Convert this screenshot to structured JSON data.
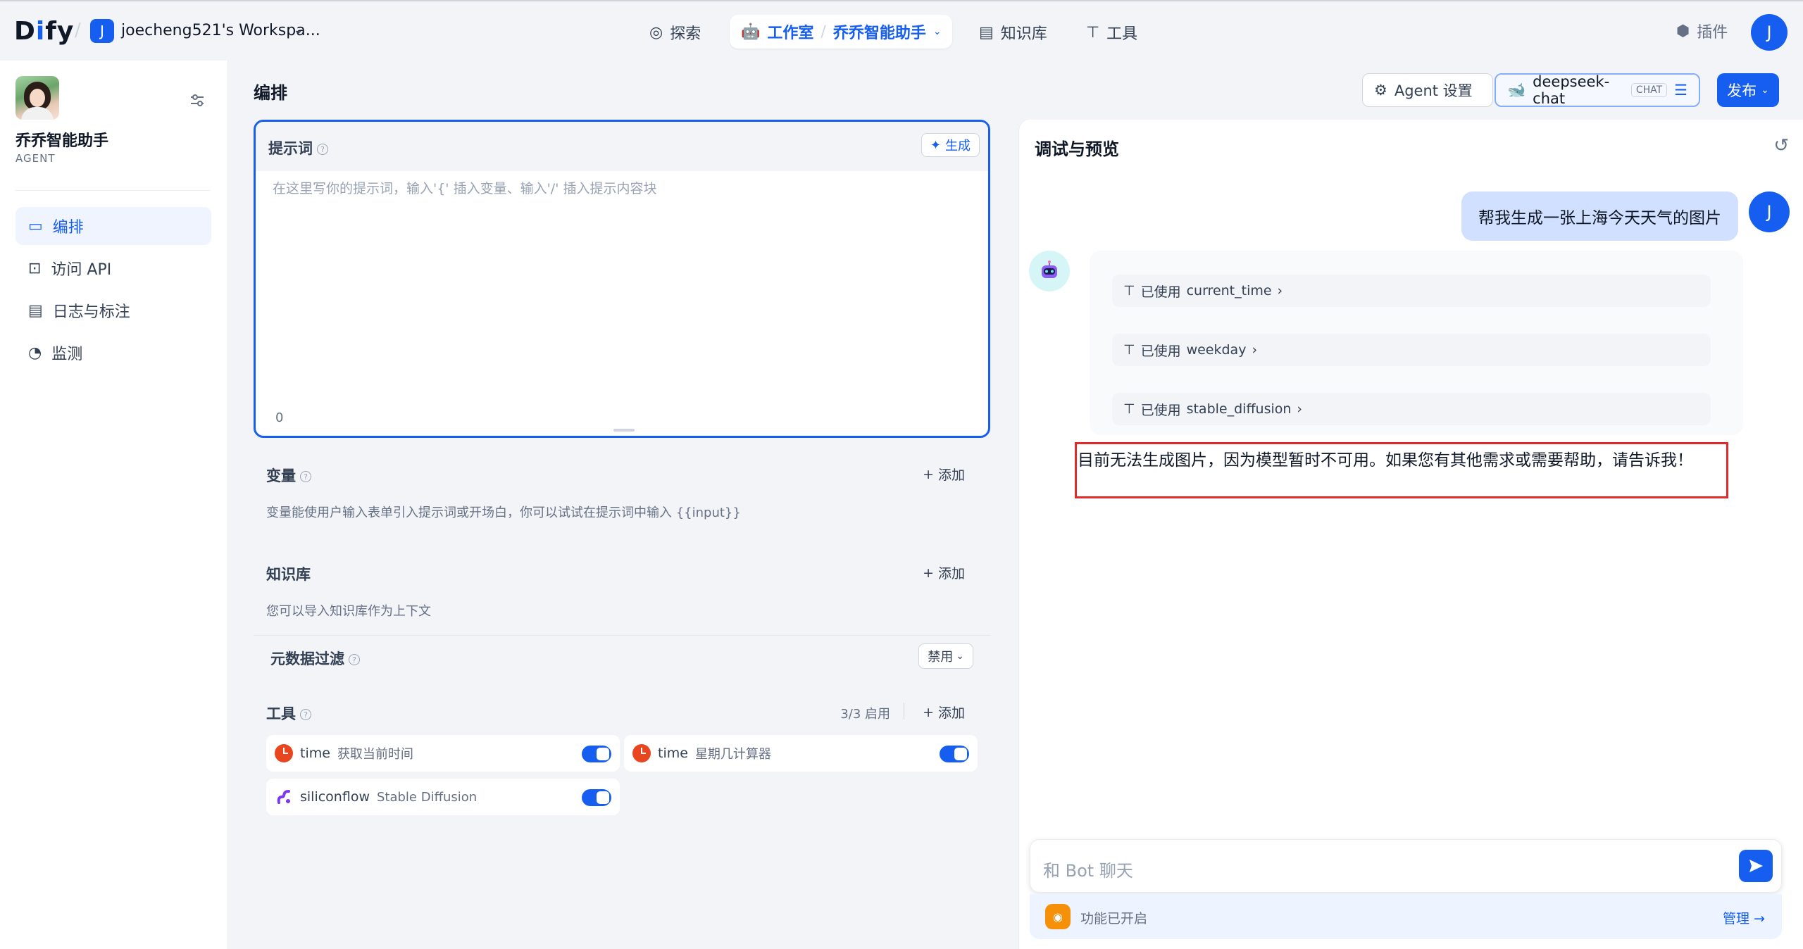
{
  "header": {
    "logo": "Dify",
    "workspace_initial": "J",
    "workspace_name": "joecheng521's Workspa...",
    "nav": {
      "explore": "探索",
      "studio": "工作室",
      "current_app": "乔乔智能助手",
      "knowledge": "知识库",
      "tools": "工具"
    },
    "plugins": "插件",
    "user_initial": "J"
  },
  "sidebar": {
    "app_name": "乔乔智能助手",
    "app_type": "AGENT",
    "items": [
      {
        "label": "编排",
        "icon": "layout-icon"
      },
      {
        "label": "访问 API",
        "icon": "terminal-icon"
      },
      {
        "label": "日志与标注",
        "icon": "log-icon"
      },
      {
        "label": "监测",
        "icon": "gauge-icon"
      }
    ]
  },
  "main": {
    "title": "编排",
    "agent_settings": "Agent 设置",
    "model_name": "deepseek-chat",
    "model_badge": "CHAT",
    "publish": "发布",
    "prompt": {
      "label": "提示词",
      "generate": "生成",
      "placeholder": "在这里写你的提示词，输入'{' 插入变量、输入'/' 插入提示内容块",
      "count": "0"
    },
    "variables": {
      "title": "变量",
      "add": "添加",
      "desc": "变量能使用户输入表单引入提示词或开场白，你可以试试在提示词中输入 {{input}}"
    },
    "knowledge": {
      "title": "知识库",
      "add": "添加",
      "desc": "您可以导入知识库作为上下文",
      "metadata_filter": "元数据过滤",
      "metadata_value": "禁用"
    },
    "tools": {
      "title": "工具",
      "enabled": "3/3 启用",
      "add": "添加",
      "items": [
        {
          "name": "time",
          "desc": "获取当前时间",
          "enabled": true
        },
        {
          "name": "time",
          "desc": "星期几计算器",
          "enabled": true
        },
        {
          "name": "siliconflow",
          "desc": "Stable Diffusion",
          "enabled": true
        }
      ]
    }
  },
  "debug": {
    "title": "调试与预览",
    "user_message": "帮我生成一张上海今天天气的图片",
    "user_initial": "J",
    "tools_used": [
      {
        "prefix": "已使用",
        "name": "current_time"
      },
      {
        "prefix": "已使用",
        "name": "weekday"
      },
      {
        "prefix": "已使用",
        "name": "stable_diffusion"
      }
    ],
    "bot_reply": "目前无法生成图片，因为模型暂时不可用。如果您有其他需求或需要帮助，请告诉我！",
    "input_placeholder": "和 Bot 聊天",
    "feature_text": "功能已开启",
    "manage": "管理"
  },
  "colors": {
    "accent": "#155eef",
    "highlight_box": "#e02b2b",
    "tool_icon": "#e9461f"
  }
}
